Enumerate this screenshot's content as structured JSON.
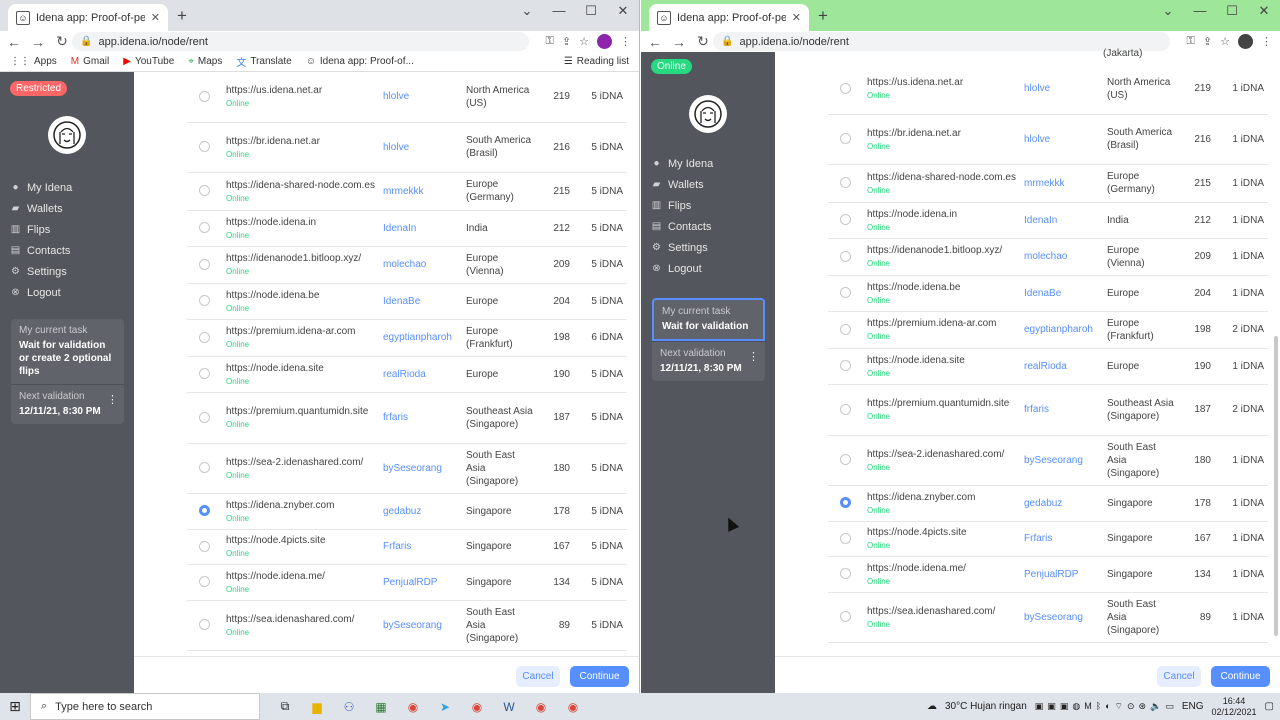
{
  "browser": {
    "tab_title": "Idena app: Proof-of-person bloc",
    "url": "app.idena.io/node/rent",
    "bookmarks": [
      "Apps",
      "Gmail",
      "YouTube",
      "Maps",
      "Translate",
      "Idena app: Proof-of..."
    ],
    "reading_list": "Reading list"
  },
  "left": {
    "badge": "Restricted",
    "nav": [
      "My Idena",
      "Wallets",
      "Flips",
      "Contacts",
      "Settings",
      "Logout"
    ],
    "task_label": "My current task",
    "task_value": "Wait for validation or create 2 optional flips",
    "next_label": "Next validation",
    "next_value": "12/11/21, 8:30 PM",
    "prices": [
      "5 iDNA",
      "5 iDNA",
      "5 iDNA",
      "5 iDNA",
      "5 iDNA",
      "5 iDNA",
      "6 iDNA",
      "5 iDNA",
      "5 iDNA",
      "5 iDNA",
      "5 iDNA",
      "5 iDNA",
      "5 iDNA",
      "5 iDNA"
    ]
  },
  "right": {
    "badge": "Online",
    "nav": [
      "My Idena",
      "Wallets",
      "Flips",
      "Contacts",
      "Settings",
      "Logout"
    ],
    "task_label": "My current task",
    "task_value": "Wait for validation",
    "next_label": "Next validation",
    "next_value": "12/11/21, 8:30 PM",
    "top_partial": "(Jakarta)",
    "prices": [
      "1 iDNA",
      "1 iDNA",
      "1 iDNA",
      "1 iDNA",
      "1 iDNA",
      "1 iDNA",
      "2 iDNA",
      "1 iDNA",
      "2 iDNA",
      "1 iDNA",
      "1 iDNA",
      "1 iDNA",
      "1 iDNA",
      "1 iDNA"
    ]
  },
  "nodes": [
    {
      "url": "https://us.idena.net.ar",
      "status": "Online",
      "owner": "hlolve",
      "location": "North America (US)",
      "slots": "219"
    },
    {
      "url": "https://br.idena.net.ar",
      "status": "Online",
      "owner": "hlolve",
      "location": "South America (Brasil)",
      "slots": "216"
    },
    {
      "url": "https://idena-shared-node.com.es",
      "status": "Online",
      "owner": "mrmekkk",
      "location": "Europe (Germany)",
      "slots": "215"
    },
    {
      "url": "https://node.idena.in",
      "status": "Online",
      "owner": "IdenaIn",
      "location": "India",
      "slots": "212"
    },
    {
      "url": "https://idenanode1.bitloop.xyz/",
      "status": "Online",
      "owner": "molechao",
      "location": "Europe (Vienna)",
      "slots": "209"
    },
    {
      "url": "https://node.idena.be",
      "status": "Online",
      "owner": "IdenaBe",
      "location": "Europe",
      "slots": "204"
    },
    {
      "url": "https://premium.idena-ar.com",
      "status": "Online",
      "owner": "egyptianpharoh",
      "location": "Europe (Frankfurt)",
      "slots": "198"
    },
    {
      "url": "https://node.idena.site",
      "status": "Online",
      "owner": "realRioda",
      "location": "Europe",
      "slots": "190"
    },
    {
      "url": "https://premium.quantumidn.site",
      "status": "Online",
      "owner": "frfaris",
      "location": "Southeast Asia (Singapore)",
      "slots": "187"
    },
    {
      "url": "https://sea-2.idenashared.com/",
      "status": "Online",
      "owner": "bySeseorang",
      "location": "South East Asia (Singapore)",
      "slots": "180"
    },
    {
      "url": "https://idena.znyber.com",
      "status": "Online",
      "owner": "gedabuz",
      "location": "Singapore",
      "slots": "178"
    },
    {
      "url": "https://node.4picts.site",
      "status": "Online",
      "owner": "Frfaris",
      "location": "Singapore",
      "slots": "167"
    },
    {
      "url": "https://node.idena.me/",
      "status": "Online",
      "owner": "PenjualRDP",
      "location": "Singapore",
      "slots": "134"
    },
    {
      "url": "https://sea.idenashared.com/",
      "status": "Online",
      "owner": "bySeseorang",
      "location": "South East Asia (Singapore)",
      "slots": "89"
    }
  ],
  "selected_index": 10,
  "buttons": {
    "cancel": "Cancel",
    "continue": "Continue"
  },
  "taskbar": {
    "search_placeholder": "Type here to search",
    "weather": "30°C  Hujan ringan",
    "lang": "ENG",
    "time": "16:44",
    "date": "02/12/2021"
  }
}
